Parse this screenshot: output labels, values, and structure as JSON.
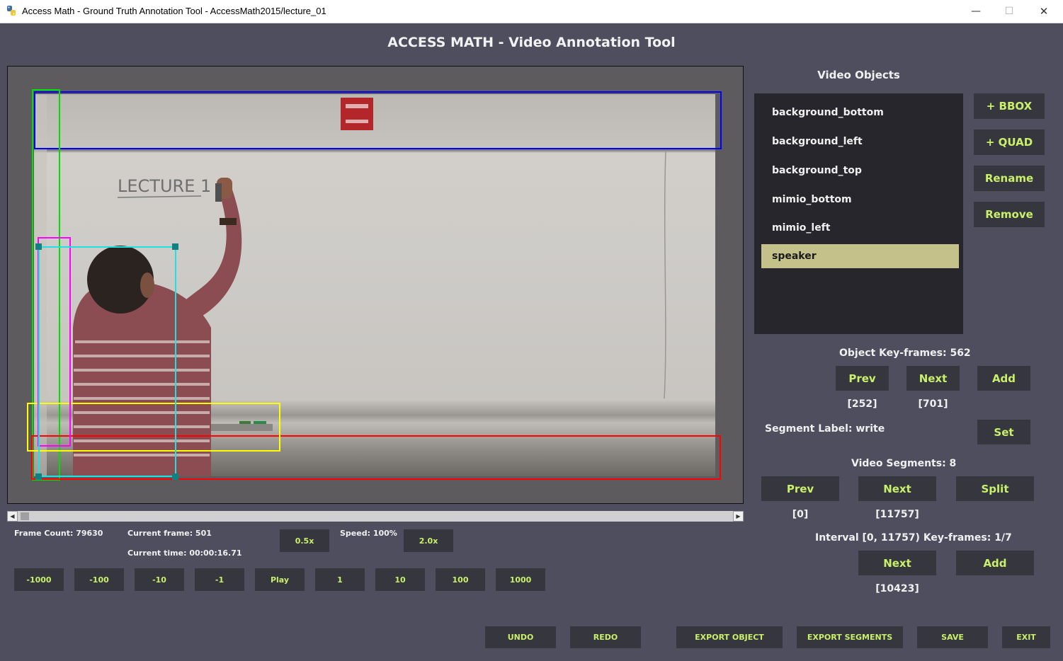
{
  "window": {
    "title": "Access Math - Ground Truth Annotation Tool - AccessMath2015/lecture_01",
    "minimize_glyph": "—",
    "maximize_glyph": "☐",
    "close_glyph": "✕"
  },
  "header": {
    "title": "ACCESS MATH - Video Annotation Tool"
  },
  "video": {
    "board_text": "LECTURE 1"
  },
  "playback": {
    "frame_count": "Frame Count: 79630",
    "current_frame": "Current frame: 501",
    "current_time": "Current time: 00:00:16.71",
    "speed": "Speed: 100%",
    "slow_label": "0.5x",
    "fast_label": "2.0x",
    "seek_buttons": [
      "-1000",
      "-100",
      "-10",
      "-1",
      "Play",
      "1",
      "10",
      "100",
      "1000"
    ]
  },
  "objects": {
    "title": "Video Objects",
    "items": [
      "background_bottom",
      "background_left",
      "background_top",
      "mimio_bottom",
      "mimio_left",
      "speaker"
    ],
    "selected": "speaker",
    "buttons": [
      "+ BBOX",
      "+ QUAD",
      "Rename",
      "Remove"
    ]
  },
  "keyframes": {
    "title": "Object Key-frames: 562",
    "prev": "Prev",
    "next": "Next",
    "add": "Add",
    "prev_value": "[252]",
    "next_value": "[701]"
  },
  "segment_label": {
    "text": "Segment Label: write",
    "set": "Set"
  },
  "segments": {
    "title": "Video Segments: 8",
    "prev": "Prev",
    "next": "Next",
    "split": "Split",
    "prev_value": "[0]",
    "next_value": "[11757]"
  },
  "interval": {
    "title": "Interval [0, 11757) Key-frames: 1/7",
    "next": "Next",
    "add": "Add",
    "next_value": "[10423]"
  },
  "bottom_bar": [
    "UNDO",
    "REDO",
    "EXPORT OBJECT",
    "EXPORT SEGMENTS",
    "SAVE",
    "EXIT"
  ],
  "colors": {
    "background": "#4e4e5e",
    "button_bg": "#36363e",
    "button_text": "#c9f06a",
    "selected_item": "#c4c18a",
    "bbox_background_top": "#0000ff",
    "bbox_background_left": "#00e000",
    "bbox_background_bottom": "#ff0000",
    "bbox_mimio_bottom": "#ffff00",
    "bbox_mimio_left": "#ff00ff",
    "bbox_speaker": "#20e0e0"
  }
}
